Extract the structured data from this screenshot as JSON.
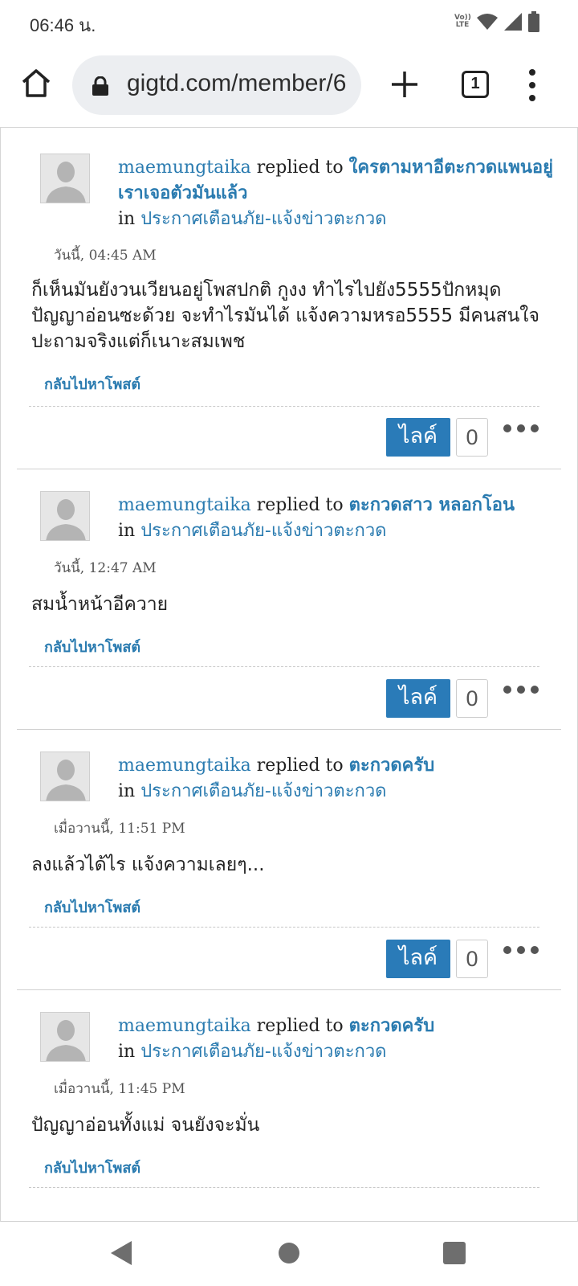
{
  "status_bar": {
    "time": "06:46 น.",
    "volte_line1": "Vo))",
    "volte_line2": "LTE",
    "icons": [
      "volte-icon",
      "wifi-icon",
      "signal-icon",
      "battery-icon"
    ]
  },
  "browser": {
    "url": "gigtd.com/member/6",
    "tab_count": "1",
    "icons": [
      "home-icon",
      "lock-icon",
      "plus-icon",
      "tabs-icon",
      "more-vert-icon"
    ]
  },
  "posts": [
    {
      "user": "maemungtaika",
      "replied_text": "replied to",
      "topic": "ใครตามหาอีตะกวดแพนอยู่ เราเจอตัวมันแล้ว",
      "in_text": "in",
      "forum": "ประกาศเตือนภัย-แจ้งข่าวตะกวด",
      "time": "วันนี้, 04:45 AM",
      "body": "ก็เห็นมันยังวนเวียนอยู่โพสปกติ กูงง ทำไรไปยัง5555ปักหมุด ปัญญาอ่อนซะด้วย จะทำไรมันได้ แจ้งความหรอ5555 มีคนสนใจปะถามจริงแต่ก็เนาะสมเพช",
      "back_link": "กลับไปหาโพสต์",
      "like_label": "ไลค์",
      "like_count": "0"
    },
    {
      "user": "maemungtaika",
      "replied_text": "replied to",
      "topic": "ตะกวดสาว หลอกโอน",
      "in_text": "in",
      "forum": "ประกาศเตือนภัย-แจ้งข่าวตะกวด",
      "time": "วันนี้, 12:47 AM",
      "body": "สมน้ำหน้าอีควาย",
      "back_link": "กลับไปหาโพสต์",
      "like_label": "ไลค์",
      "like_count": "0"
    },
    {
      "user": "maemungtaika",
      "replied_text": "replied to",
      "topic": "ตะกวดครับ",
      "in_text": "in",
      "forum": "ประกาศเตือนภัย-แจ้งข่าวตะกวด",
      "time": "เมื่อวานนี้, 11:51 PM",
      "body": "ลงแล้วได้ไร แจ้งความเลยๆ...",
      "back_link": "กลับไปหาโพสต์",
      "like_label": "ไลค์",
      "like_count": "0"
    },
    {
      "user": "maemungtaika",
      "replied_text": "replied to",
      "topic": "ตะกวดครับ",
      "in_text": "in",
      "forum": "ประกาศเตือนภัย-แจ้งข่าวตะกวด",
      "time": "เมื่อวานนี้, 11:45 PM",
      "body": "ปัญญาอ่อนทั้งแม่ จนยังจะมั่น",
      "back_link": "กลับไปหาโพสต์"
    }
  ],
  "colors": {
    "link": "#2a7bb0",
    "like_button": "#2a7bb8"
  }
}
